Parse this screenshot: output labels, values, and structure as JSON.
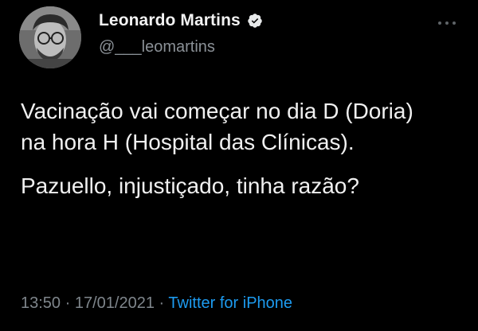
{
  "author": {
    "display_name": "Leonardo Martins",
    "handle": "@___leomartins",
    "verified": true,
    "verified_color": "#1d9bf0"
  },
  "icons": {
    "verified": "verified-badge-icon",
    "more": "more-options-icon"
  },
  "tweet": {
    "paragraph_1": "Vacinação vai começar no dia D (Doria) na hora H (Hospital das Clínicas).",
    "paragraph_2": "Pazuello, injustiçado, tinha razão?"
  },
  "meta": {
    "time": "13:50",
    "separator": "·",
    "date": "17/01/2021",
    "source": "Twitter for iPhone",
    "source_color": "#1d9bf0"
  }
}
